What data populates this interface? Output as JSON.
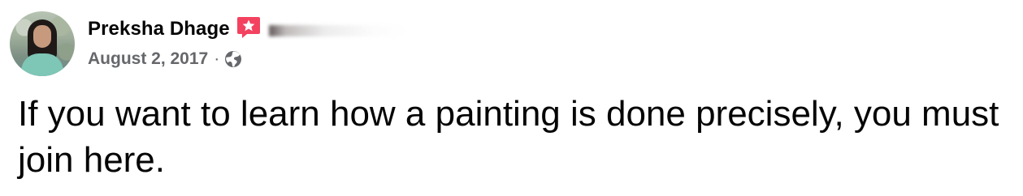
{
  "post": {
    "author": {
      "name": "Preksha Dhage",
      "avatar_icon": "profile-photo"
    },
    "badge_icon": "star-badge-icon",
    "date": "August 2, 2017",
    "separator": "·",
    "privacy_icon": "globe-icon",
    "text": "If you want to learn how a painting is done precisely, you must join here."
  },
  "colors": {
    "text_primary": "#050505",
    "text_secondary": "#65676b",
    "badge": "#f3425f",
    "background": "#ffffff"
  }
}
